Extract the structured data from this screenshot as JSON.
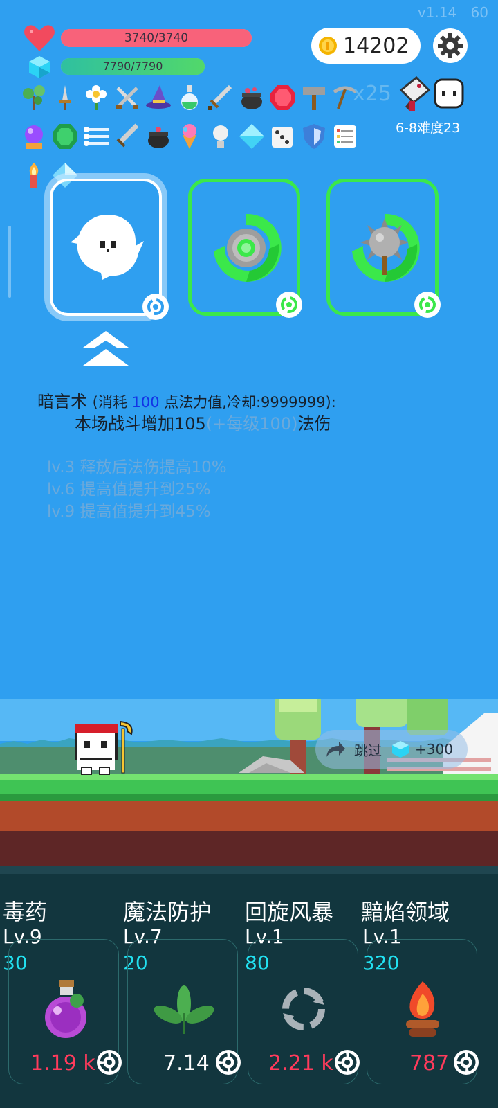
{
  "version": "v1.14",
  "fps": "60",
  "hp": {
    "text": "3740/3740",
    "fraction": 1.0,
    "color": "#f8627a"
  },
  "mp": {
    "text": "7790/7790",
    "fraction": 1.0,
    "color": "#3fcf7b"
  },
  "coins": "14202",
  "stage": {
    "label": "6-8难度23"
  },
  "item_multiplier": "x25",
  "items_row1": [
    "sapling-icon",
    "dagger-icon",
    "white-flower-icon",
    "crossed-swords-icon",
    "wizard-hat-icon",
    "green-potion-icon",
    "long-sword-icon",
    "cauldron-icon",
    "ruby-icon",
    "hammer-icon",
    "pickaxe-icon"
  ],
  "items_row2": [
    "crystal-ball-icon",
    "emerald-icon",
    "triple-lines-icon",
    "broadsword-icon",
    "black-pot-icon",
    "ice-cream-icon",
    "light-bulb-icon",
    "diamond-icon",
    "dice-icon",
    "shield-icon",
    "scroll-list-icon"
  ],
  "items_row3": [
    "torch-icon",
    "crystal-icon"
  ],
  "skill_cards": [
    {
      "name": "ghost-skill-card",
      "selected": true
    },
    {
      "name": "vortex-shield-skill-card",
      "selected": false
    },
    {
      "name": "spiked-mace-skill-card",
      "selected": false
    }
  ],
  "skill_desc": {
    "name": "暗言术",
    "cost_prefix": "(消耗 ",
    "cost_value": "100",
    "cost_suffix": " 点法力值,冷却:9999999):",
    "effect_prefix": "本场战斗增加105",
    "effect_dim": "(+每级100)",
    "effect_suffix": "法伤",
    "levels": [
      "lv.3 释放后法伤提高10%",
      "lv.6 提高值提升到25%",
      "lv.9 提高值提升到45%"
    ]
  },
  "skip": {
    "label": "跳过",
    "reward": "+300"
  },
  "upgrades": [
    {
      "name": "毒药",
      "level": "Lv.9",
      "cost": "30",
      "value": "1.19 k",
      "value_color": "#ff3b5c",
      "icon": "poison-flask-icon"
    },
    {
      "name": "魔法防护",
      "level": "Lv.7",
      "cost": "20",
      "value": "7.14",
      "value_color": "#ffffff",
      "icon": "leaves-icon"
    },
    {
      "name": "回旋风暴",
      "level": "Lv.1",
      "cost": "80",
      "value": "2.21 k",
      "value_color": "#ff3b5c",
      "icon": "whirlwind-icon"
    },
    {
      "name": "黯焰领域",
      "level": "Lv.1",
      "cost": "320",
      "value": "787",
      "value_color": "#ff3b5c",
      "icon": "campfire-icon"
    }
  ]
}
